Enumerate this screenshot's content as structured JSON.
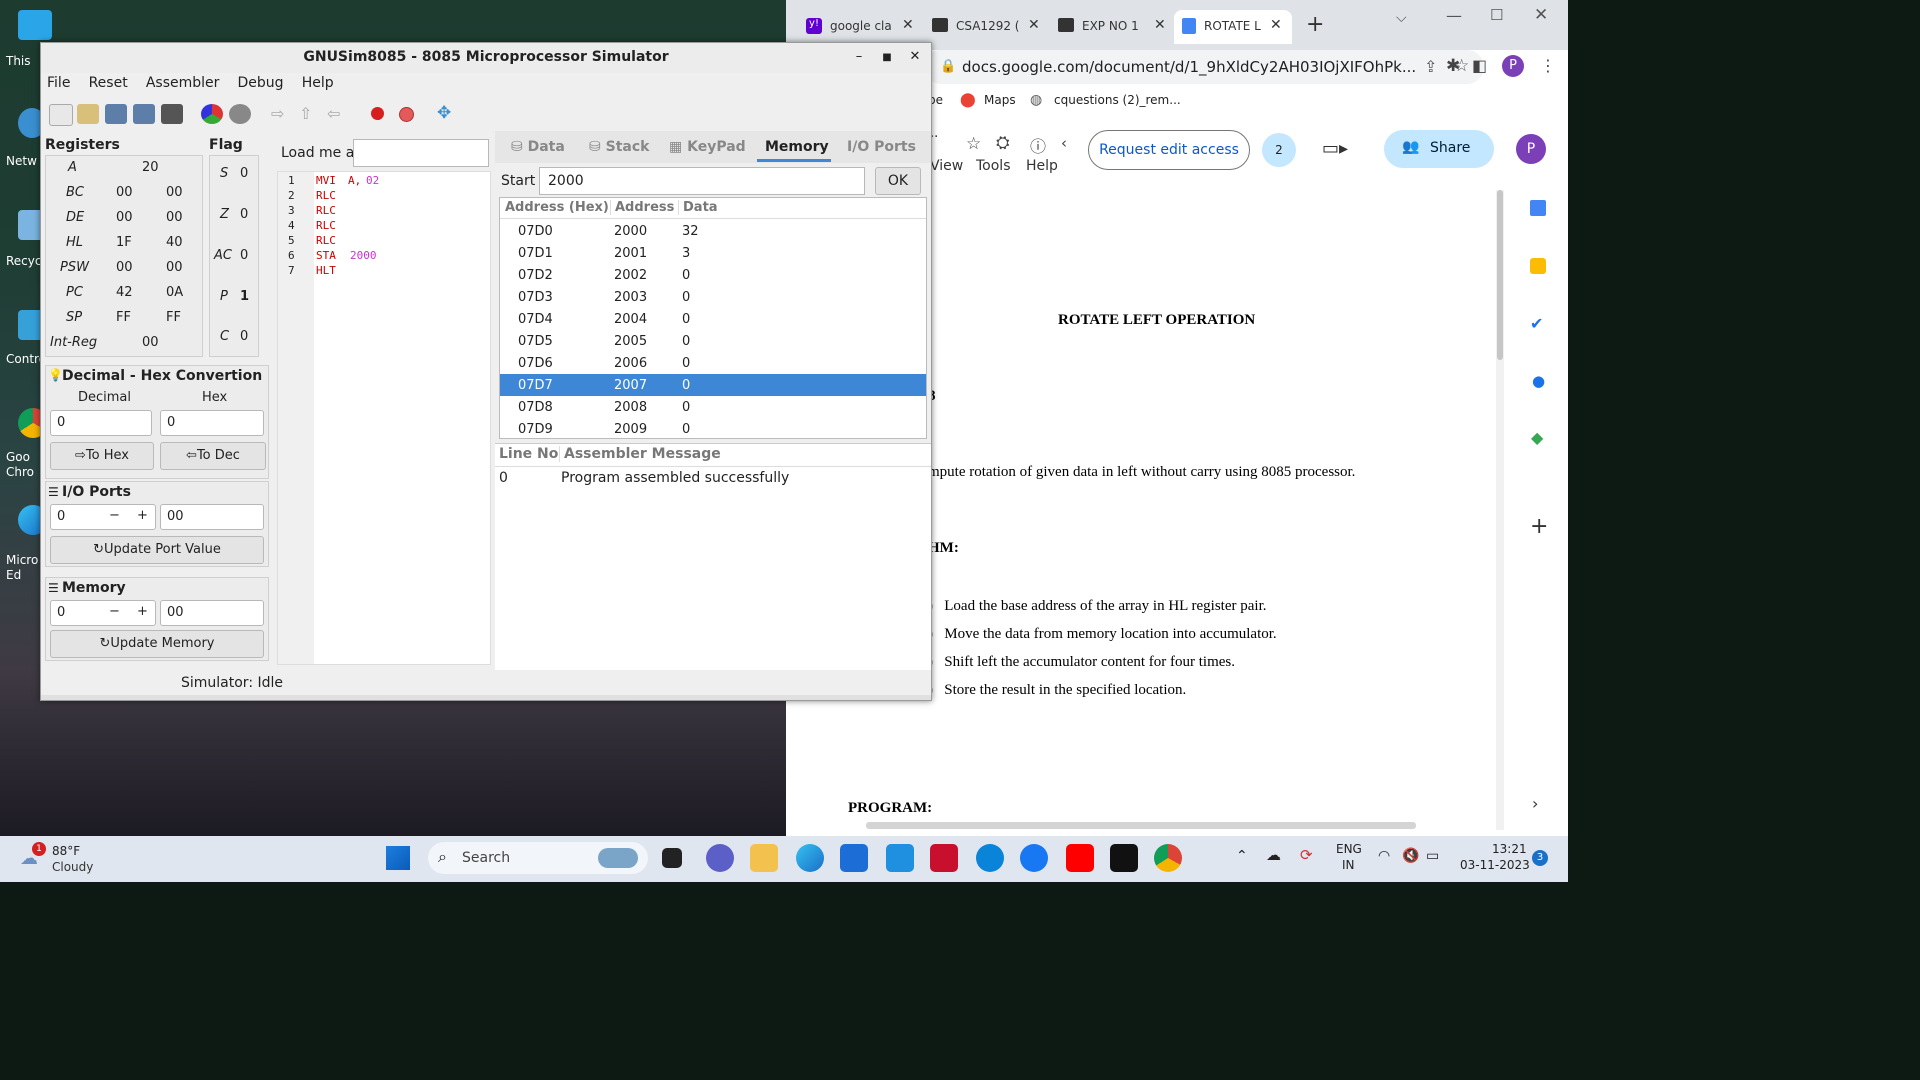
{
  "desktop": {
    "icons": [
      {
        "label": "This"
      },
      {
        "label": "Netw"
      },
      {
        "label": "Recyc"
      },
      {
        "label": "Contro"
      },
      {
        "label": "Goo\nChro"
      },
      {
        "label": "Micro\nEd"
      }
    ]
  },
  "gnusim": {
    "title": "GNUSim8085 - 8085 Microprocessor Simulator",
    "menu": [
      "File",
      "Reset",
      "Assembler",
      "Debug",
      "Help"
    ],
    "registers_title": "Registers",
    "registers": [
      {
        "name": "A",
        "v1": "20",
        "v2": ""
      },
      {
        "name": "BC",
        "v1": "00",
        "v2": "00"
      },
      {
        "name": "DE",
        "v1": "00",
        "v2": "00"
      },
      {
        "name": "HL",
        "v1": "1F",
        "v2": "40"
      },
      {
        "name": "PSW",
        "v1": "00",
        "v2": "00"
      },
      {
        "name": "PC",
        "v1": "42",
        "v2": "0A"
      },
      {
        "name": "SP",
        "v1": "FF",
        "v2": "FF"
      },
      {
        "name": "Int-Reg",
        "v1": "00",
        "v2": ""
      }
    ],
    "flag_title": "Flag",
    "flags": [
      {
        "name": "S",
        "v": "0"
      },
      {
        "name": "Z",
        "v": "0"
      },
      {
        "name": "AC",
        "v": "0"
      },
      {
        "name": "P",
        "v": "1"
      },
      {
        "name": "C",
        "v": "0"
      }
    ],
    "dechex": {
      "title": "Decimal - Hex Convertion",
      "dec_label": "Decimal",
      "hex_label": "Hex",
      "dec_value": "0",
      "hex_value": "0",
      "to_hex": "To Hex",
      "to_dec": "To Dec"
    },
    "io": {
      "title": "I/O Ports",
      "port": "0",
      "minus": "−",
      "plus": "+",
      "value": "00",
      "update": "Update Port Value"
    },
    "memory": {
      "title": "Memory",
      "addr": "0",
      "minus": "−",
      "plus": "+",
      "value": "00",
      "update": "Update Memory"
    },
    "load_label": "Load me at",
    "code_lines": [
      {
        "n": "1",
        "op": "MVI",
        "arg": "A,",
        "arg2": "02"
      },
      {
        "n": "2",
        "op": "RLC",
        "arg": "",
        "arg2": ""
      },
      {
        "n": "3",
        "op": "RLC",
        "arg": "",
        "arg2": ""
      },
      {
        "n": "4",
        "op": "RLC",
        "arg": "",
        "arg2": ""
      },
      {
        "n": "5",
        "op": "RLC",
        "arg": "",
        "arg2": ""
      },
      {
        "n": "6",
        "op": "STA",
        "arg": "",
        "arg2": "2000"
      },
      {
        "n": "7",
        "op": "HLT",
        "arg": "",
        "arg2": ""
      }
    ],
    "tabs": [
      "Data",
      "Stack",
      "KeyPad",
      "Memory",
      "I/O Ports"
    ],
    "active_tab": "Memory",
    "start_label": "Start",
    "start_value": "2000",
    "ok": "OK",
    "mem_headers": [
      "Address (Hex)",
      "Address",
      "Data"
    ],
    "mem_rows": [
      [
        "07D0",
        "2000",
        "32"
      ],
      [
        "07D1",
        "2001",
        "3"
      ],
      [
        "07D2",
        "2002",
        "0"
      ],
      [
        "07D3",
        "2003",
        "0"
      ],
      [
        "07D4",
        "2004",
        "0"
      ],
      [
        "07D5",
        "2005",
        "0"
      ],
      [
        "07D6",
        "2006",
        "0"
      ],
      [
        "07D7",
        "2007",
        "0"
      ],
      [
        "07D8",
        "2008",
        "0"
      ],
      [
        "07D9",
        "2009",
        "0"
      ]
    ],
    "selected_row": 7,
    "msg_headers": [
      "Line No",
      "Assembler Message"
    ],
    "msg_rows": [
      [
        "0",
        "Program assembled successfully"
      ]
    ],
    "status": "Simulator: Idle"
  },
  "chrome": {
    "tabs": [
      "google cla",
      "CSA1292 (",
      "EXP NO 1",
      "ROTATE L"
    ],
    "url": "docs.google.com/document/d/1_9hXldCy2AH03IOjXIFOhPk...",
    "bookmarks": [
      "be",
      "Maps",
      "cquestions (2)_rem..."
    ],
    "docs_menu": [
      "View",
      "Tools",
      "Help"
    ],
    "request_edit": "Request edit access",
    "share": "Share",
    "avatar": "P",
    "badge": "2",
    "doc": {
      "heading": "ROTATE LEFT OPERATION",
      "frag_8": "8",
      "aim": "mpute rotation of given data in left without carry using 8085 processor.",
      "algo": "HM:",
      "steps": [
        "Load the base address of the array in HL register pair.",
        "Move the data from memory location into accumulator.",
        "Shift left the accumulator content for four times.",
        "Store the result in the specified location."
      ],
      "program": "PROGRAM:"
    }
  },
  "taskbar": {
    "weather_temp": "88°F",
    "weather_desc": "Cloudy",
    "weather_badge": "1",
    "search": "Search",
    "lang1": "ENG",
    "lang2": "IN",
    "time": "13:21",
    "date": "03-11-2023",
    "notif": "3"
  },
  "colors": {
    "selection": "#3d87d6",
    "code_red": "#cc0000",
    "code_mag": "#cc33cc",
    "share_bg": "#c2e7ff"
  }
}
